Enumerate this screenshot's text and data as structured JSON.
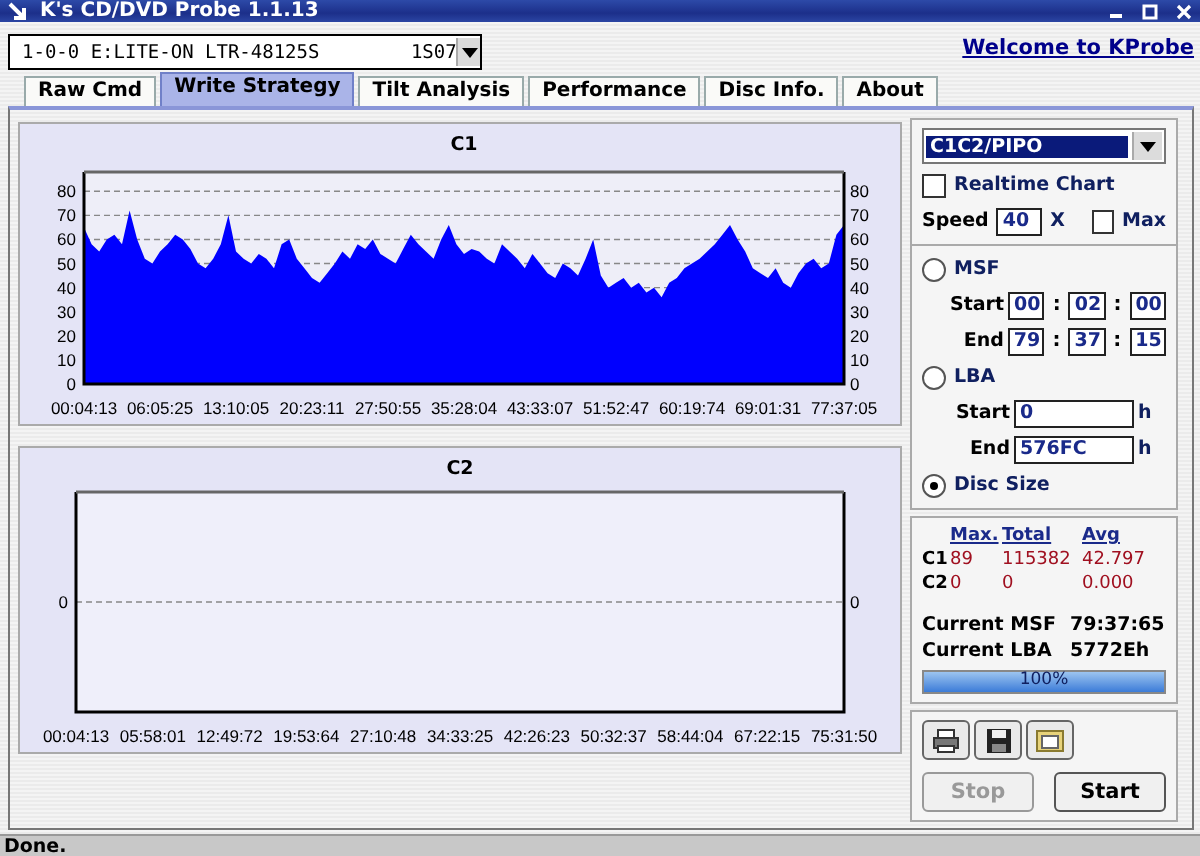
{
  "window": {
    "title": "K's CD/DVD Probe 1.1.13"
  },
  "drive_select": {
    "value": "1-0-0 E:LITE-ON LTR-48125S        1S07"
  },
  "welcome_link": "Welcome to KProbe",
  "tabs": [
    {
      "label": "Raw Cmd",
      "selected": false
    },
    {
      "label": "Write Strategy",
      "selected": true
    },
    {
      "label": "Tilt Analysis",
      "selected": false
    },
    {
      "label": "Performance",
      "selected": false
    },
    {
      "label": "Disc Info.",
      "selected": false
    },
    {
      "label": "About",
      "selected": false
    }
  ],
  "charts": [
    {
      "chart_data": {
        "type": "area",
        "title": "C1",
        "grid": true,
        "ylim": [
          0,
          88
        ],
        "yticks": [
          0,
          10,
          20,
          30,
          40,
          50,
          60,
          70,
          80
        ],
        "y2lim": [
          0,
          88
        ],
        "y2ticks": [
          0,
          10,
          20,
          30,
          40,
          50,
          60,
          70,
          80
        ],
        "categories": [
          "00:04:13",
          null,
          null,
          null,
          null,
          null,
          null,
          null,
          null,
          null,
          "06:05:25",
          null,
          null,
          null,
          null,
          null,
          null,
          null,
          null,
          null,
          "13:10:05",
          null,
          null,
          null,
          null,
          null,
          null,
          null,
          null,
          null,
          "20:23:11",
          null,
          null,
          null,
          null,
          null,
          null,
          null,
          null,
          null,
          "27:50:55",
          null,
          null,
          null,
          null,
          null,
          null,
          null,
          null,
          null,
          "35:28:04",
          null,
          null,
          null,
          null,
          null,
          null,
          null,
          null,
          null,
          "43:33:07",
          null,
          null,
          null,
          null,
          null,
          null,
          null,
          null,
          null,
          "51:52:47",
          null,
          null,
          null,
          null,
          null,
          null,
          null,
          null,
          null,
          "60:19:74",
          null,
          null,
          null,
          null,
          null,
          null,
          null,
          null,
          null,
          "69:01:31",
          null,
          null,
          null,
          null,
          null,
          null,
          null,
          null,
          null,
          "77:37:05"
        ],
        "series": [
          {
            "color": "#0000ff",
            "values": [
              65,
              58,
              55,
              60,
              62,
              58,
              72,
              60,
              52,
              50,
              55,
              58,
              62,
              60,
              56,
              50,
              48,
              52,
              58,
              70,
              55,
              52,
              50,
              54,
              52,
              48,
              58,
              60,
              52,
              48,
              44,
              42,
              46,
              50,
              55,
              52,
              58,
              56,
              60,
              54,
              52,
              50,
              56,
              62,
              58,
              55,
              52,
              60,
              66,
              58,
              54,
              56,
              55,
              52,
              50,
              58,
              55,
              52,
              48,
              54,
              50,
              46,
              44,
              50,
              48,
              45,
              52,
              60,
              45,
              40,
              42,
              44,
              40,
              42,
              38,
              40,
              36,
              42,
              44,
              48,
              50,
              52,
              55,
              58,
              62,
              66,
              60,
              55,
              48,
              46,
              44,
              48,
              42,
              40,
              46,
              50,
              52,
              48,
              50,
              62,
              66
            ]
          }
        ]
      }
    },
    {
      "chart_data": {
        "type": "other",
        "title": "C2",
        "categories": [
          "00:04:13",
          "05:58:01",
          "12:49:72",
          "19:53:64",
          "27:10:48",
          "34:33:25",
          "42:26:23",
          "50:32:37",
          "58:44:04",
          "67:22:15",
          "75:31:50"
        ],
        "annotations": [
          {
            "text": "0"
          },
          {
            "text": "0"
          }
        ]
      }
    }
  ],
  "side": {
    "mode_select": {
      "value": "C1C2/PIPO"
    },
    "realtime_chart": {
      "label": "Realtime Chart",
      "checked": false
    },
    "speed": {
      "label": "Speed",
      "value": "40",
      "unit": "X"
    },
    "max": {
      "label": "Max",
      "checked": false
    },
    "msf": {
      "label": "MSF",
      "selected": false,
      "start_label": "Start",
      "start": [
        "00",
        ":",
        "02",
        ":",
        "00"
      ],
      "end_label": "End",
      "end": [
        "79",
        ":",
        "37",
        ":",
        "15"
      ]
    },
    "lba": {
      "label": "LBA",
      "selected": false,
      "start_label": "Start",
      "start": "0",
      "start_unit": "h",
      "end_label": "End",
      "end": "576FC",
      "end_unit": "h"
    },
    "disc_size": {
      "label": "Disc Size",
      "selected": true
    },
    "stats": {
      "columns": [
        "Max.",
        "Total",
        "Avg"
      ],
      "rows": [
        {
          "name": "C1",
          "values": [
            "89",
            "115382",
            "42.797"
          ]
        },
        {
          "name": "C2",
          "values": [
            "0",
            "0",
            "0.000"
          ]
        }
      ]
    },
    "current_msf": {
      "label": "Current MSF",
      "value": "79:37:65"
    },
    "current_lba": {
      "label": "Current LBA",
      "value": "5772Eh"
    },
    "progress": {
      "level": 1.0,
      "text": "100%"
    },
    "buttons": [
      {
        "label": "Stop",
        "disabled": true
      },
      {
        "label": "Start",
        "disabled": false
      }
    ]
  },
  "status_bar": "Done."
}
